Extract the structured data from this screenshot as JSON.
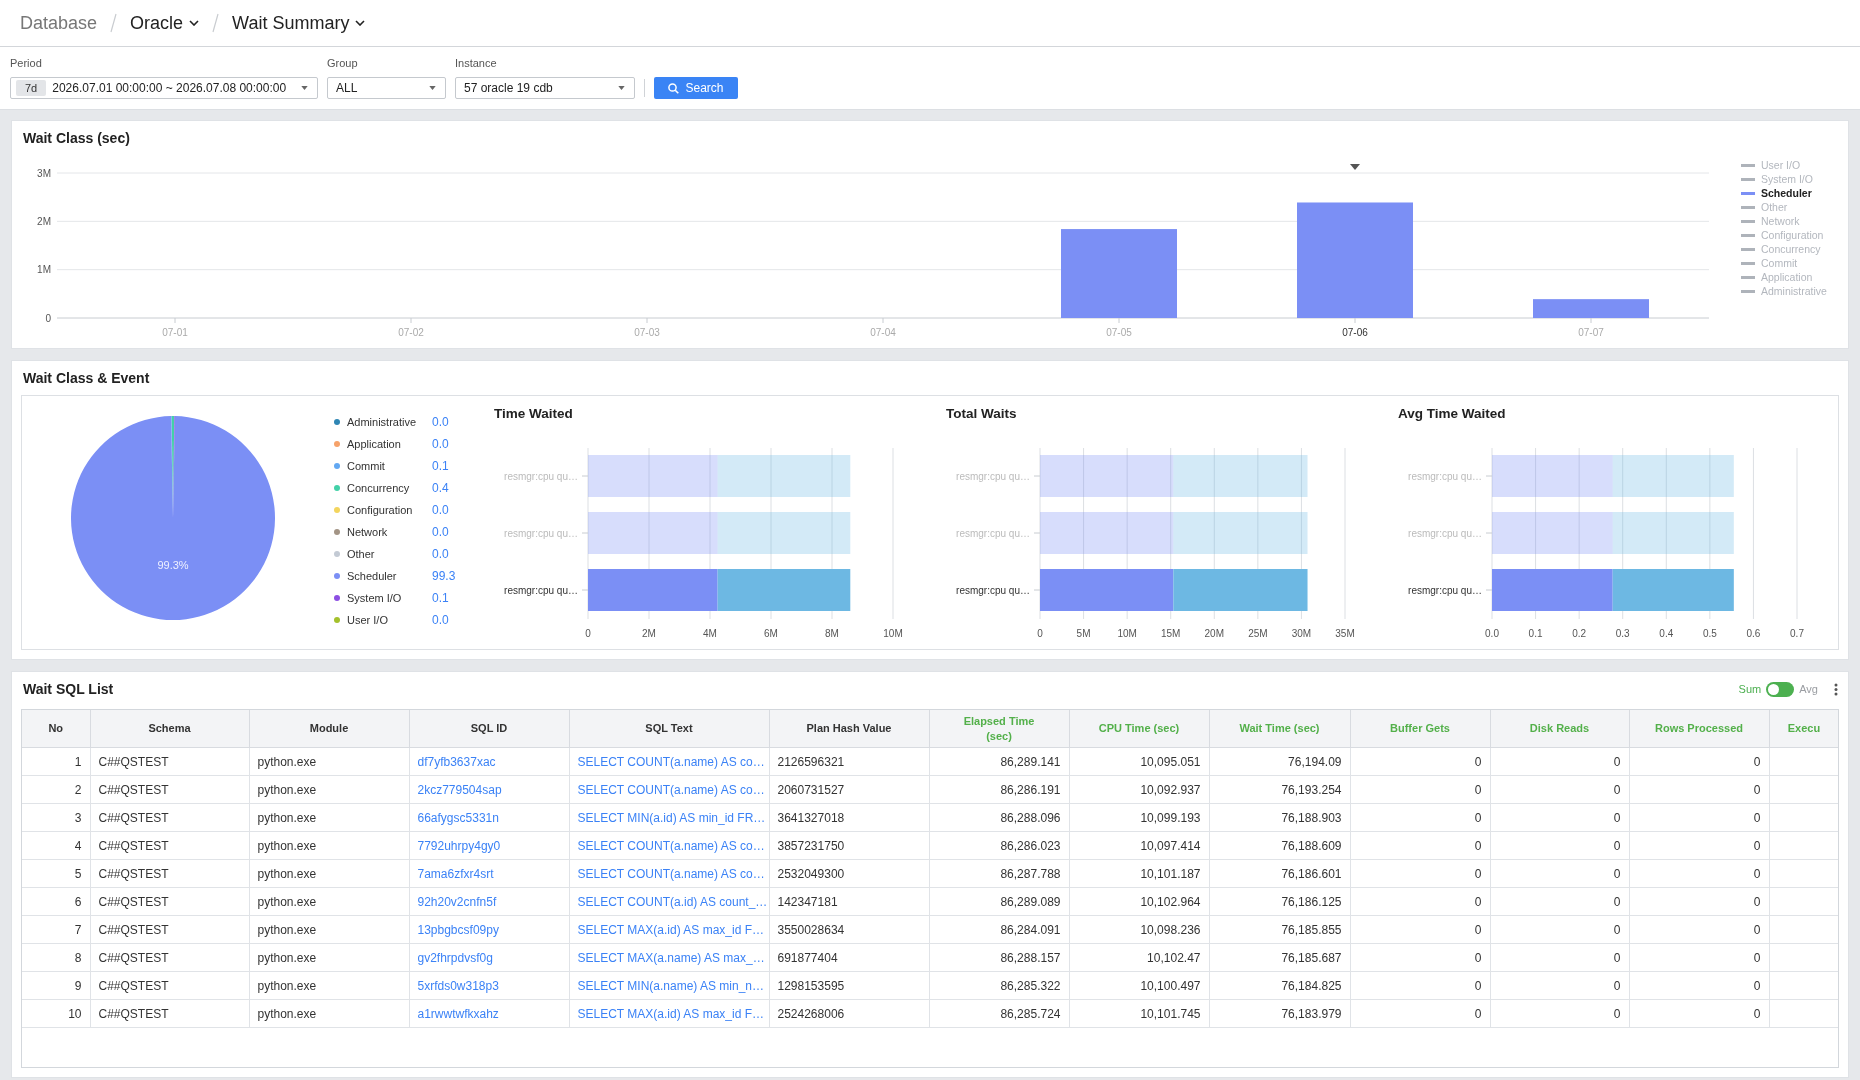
{
  "breadcrumb": [
    {
      "label": "Database",
      "dropdown": false
    },
    {
      "label": "Oracle",
      "dropdown": true
    },
    {
      "label": "Wait Summary",
      "dropdown": true
    }
  ],
  "filters": {
    "period": {
      "label": "Period",
      "badge": "7d",
      "value": "2026.07.01 00:00:00 ~ 2026.07.08 00:00:00"
    },
    "group": {
      "label": "Group",
      "value": "ALL"
    },
    "instance": {
      "label": "Instance",
      "value": "57 oracle 19 cdb"
    },
    "search_button": "Search"
  },
  "wait_class": {
    "title": "Wait Class (sec)",
    "category_states": [
      {
        "selected": false
      },
      {
        "selected": false
      },
      {
        "selected": false
      },
      {
        "selected": false
      },
      {
        "selected": false
      },
      {
        "selected": true
      },
      {
        "selected": false
      }
    ],
    "legend": [
      {
        "label": "User I/O",
        "selected": false
      },
      {
        "label": "System I/O",
        "selected": false
      },
      {
        "label": "Scheduler",
        "selected": true
      },
      {
        "label": "Other",
        "selected": false
      },
      {
        "label": "Network",
        "selected": false
      },
      {
        "label": "Configuration",
        "selected": false
      },
      {
        "label": "Concurrency",
        "selected": false
      },
      {
        "label": "Commit",
        "selected": false
      },
      {
        "label": "Application",
        "selected": false
      },
      {
        "label": "Administrative",
        "selected": false
      }
    ],
    "chart_data": {
      "type": "bar",
      "grid": true,
      "categories": [
        "07-01",
        "07-02",
        "07-03",
        "07-04",
        "07-05",
        "07-06",
        "07-07"
      ],
      "series": [
        {
          "color": "#7b8ff5",
          "values": [
            0,
            0,
            0,
            0,
            1840000,
            2390000,
            390000
          ]
        }
      ],
      "ylim": [
        0,
        3000000
      ],
      "yticks": [
        {
          "value": 0,
          "label": "0"
        },
        {
          "value": 1000000,
          "label": "1M"
        },
        {
          "value": 2000000,
          "label": "2M"
        },
        {
          "value": 3000000,
          "label": "3M"
        }
      ]
    }
  },
  "wait_class_event": {
    "title": "Wait Class & Event",
    "pie": {
      "legend": [
        {
          "label": "Administrative",
          "value": "0.0",
          "color": "#2f86b4"
        },
        {
          "label": "Application",
          "value": "0.0",
          "color": "#f6a26a"
        },
        {
          "label": "Commit",
          "value": "0.1",
          "color": "#62a8f2"
        },
        {
          "label": "Concurrency",
          "value": "0.4",
          "color": "#43d1a8"
        },
        {
          "label": "Configuration",
          "value": "0.0",
          "color": "#f3d55e"
        },
        {
          "label": "Network",
          "value": "0.0",
          "color": "#a39485"
        },
        {
          "label": "Other",
          "value": "0.0",
          "color": "#c3cad4"
        },
        {
          "label": "Scheduler",
          "value": "99.3",
          "color": "#7b8ff5"
        },
        {
          "label": "System I/O",
          "value": "0.1",
          "color": "#8c4fe3"
        },
        {
          "label": "User I/O",
          "value": "0.0",
          "color": "#a4c12c"
        }
      ],
      "chart_data": {
        "type": "pie",
        "values": [
          0,
          0,
          0.1,
          0.4,
          0,
          0,
          0,
          99.3,
          0.1,
          0
        ],
        "annotations": [
          {
            "text": "99.3%"
          }
        ]
      }
    },
    "charts": [
      {
        "bars": [
          {
            "selected": false
          },
          {
            "selected": false
          },
          {
            "selected": true
          }
        ],
        "chart_data": {
          "type": "bar",
          "title": "Time Waited",
          "orientation": "horizontal",
          "stacked": true,
          "grid": true,
          "categories": [
            "resmgr:cpu qu…",
            "resmgr:cpu qu…",
            "resmgr:cpu qu…"
          ],
          "series": [
            {
              "color": "#7b8ff5",
              "values": [
                4250000,
                4250000,
                4250000
              ]
            },
            {
              "color": "#6db8e3",
              "values": [
                4350000,
                4350000,
                4350000
              ]
            }
          ],
          "xlim": [
            0,
            10000000
          ],
          "xticks": [
            {
              "value": 0,
              "label": "0"
            },
            {
              "value": 2000000,
              "label": "2M"
            },
            {
              "value": 4000000,
              "label": "4M"
            },
            {
              "value": 6000000,
              "label": "6M"
            },
            {
              "value": 8000000,
              "label": "8M"
            },
            {
              "value": 10000000,
              "label": "10M"
            }
          ]
        }
      },
      {
        "bars": [
          {
            "selected": false
          },
          {
            "selected": false
          },
          {
            "selected": true
          }
        ],
        "chart_data": {
          "type": "bar",
          "title": "Total Waits",
          "orientation": "horizontal",
          "stacked": true,
          "grid": true,
          "categories": [
            "resmgr:cpu qu…",
            "resmgr:cpu qu…",
            "resmgr:cpu qu…"
          ],
          "series": [
            {
              "color": "#7b8ff5",
              "values": [
                15300000,
                15300000,
                15300000
              ]
            },
            {
              "color": "#6db8e3",
              "values": [
                15400000,
                15400000,
                15400000
              ]
            }
          ],
          "xlim": [
            0,
            35000000
          ],
          "xticks": [
            {
              "value": 0,
              "label": "0"
            },
            {
              "value": 5000000,
              "label": "5M"
            },
            {
              "value": 10000000,
              "label": "10M"
            },
            {
              "value": 15000000,
              "label": "15M"
            },
            {
              "value": 20000000,
              "label": "20M"
            },
            {
              "value": 25000000,
              "label": "25M"
            },
            {
              "value": 30000000,
              "label": "30M"
            },
            {
              "value": 35000000,
              "label": "35M"
            }
          ]
        }
      },
      {
        "bars": [
          {
            "selected": false
          },
          {
            "selected": false
          },
          {
            "selected": true
          }
        ],
        "chart_data": {
          "type": "bar",
          "title": "Avg Time Waited",
          "orientation": "horizontal",
          "stacked": true,
          "grid": true,
          "categories": [
            "resmgr:cpu qu…",
            "resmgr:cpu qu…",
            "resmgr:cpu qu…"
          ],
          "series": [
            {
              "color": "#7b8ff5",
              "values": [
                0.277,
                0.277,
                0.277
              ]
            },
            {
              "color": "#6db8e3",
              "values": [
                0.278,
                0.278,
                0.278
              ]
            }
          ],
          "xlim": [
            0,
            0.7
          ],
          "xticks": [
            {
              "value": 0,
              "label": "0.0"
            },
            {
              "value": 0.1,
              "label": "0.1"
            },
            {
              "value": 0.2,
              "label": "0.2"
            },
            {
              "value": 0.3,
              "label": "0.3"
            },
            {
              "value": 0.4,
              "label": "0.4"
            },
            {
              "value": 0.5,
              "label": "0.5"
            },
            {
              "value": 0.6,
              "label": "0.6"
            },
            {
              "value": 0.7,
              "label": "0.7"
            }
          ]
        }
      }
    ]
  },
  "wait_sql_list": {
    "title": "Wait SQL List",
    "toggle": {
      "options": [
        {
          "label": "Sum",
          "selected": true
        },
        {
          "label": "Avg",
          "selected": false
        }
      ]
    },
    "table": {
      "columns": [
        {
          "label": "No",
          "kind": "index"
        },
        {
          "label": "Schema",
          "kind": "text"
        },
        {
          "label": "Module",
          "kind": "text"
        },
        {
          "label": "SQL ID",
          "kind": "link"
        },
        {
          "label": "SQL Text",
          "kind": "link"
        },
        {
          "label": "Plan Hash Value",
          "kind": "text"
        },
        {
          "label": "Elapsed Time (sec)",
          "kind": "metric"
        },
        {
          "label": "CPU Time (sec)",
          "kind": "metric"
        },
        {
          "label": "Wait Time (sec)",
          "kind": "metric"
        },
        {
          "label": "Buffer Gets",
          "kind": "metric"
        },
        {
          "label": "Disk Reads",
          "kind": "metric"
        },
        {
          "label": "Rows Processed",
          "kind": "metric"
        },
        {
          "label": "Execu",
          "kind": "metric"
        }
      ],
      "rows": [
        {
          "cells": [
            "1",
            "C##QSTEST",
            "python.exe",
            "df7yfb3637xac",
            "SELECT COUNT(a.name) AS co…",
            "2126596321",
            "86,289.141",
            "10,095.051",
            "76,194.09",
            "0",
            "0",
            "0"
          ]
        },
        {
          "cells": [
            "2",
            "C##QSTEST",
            "python.exe",
            "2kcz779504sap",
            "SELECT COUNT(a.name) AS co…",
            "2060731527",
            "86,286.191",
            "10,092.937",
            "76,193.254",
            "0",
            "0",
            "0"
          ]
        },
        {
          "cells": [
            "3",
            "C##QSTEST",
            "python.exe",
            "66afygsc5331n",
            "SELECT MIN(a.id) AS min_id FR…",
            "3641327018",
            "86,288.096",
            "10,099.193",
            "76,188.903",
            "0",
            "0",
            "0"
          ]
        },
        {
          "cells": [
            "4",
            "C##QSTEST",
            "python.exe",
            "7792uhrpy4gy0",
            "SELECT COUNT(a.name) AS co…",
            "3857231750",
            "86,286.023",
            "10,097.414",
            "76,188.609",
            "0",
            "0",
            "0"
          ]
        },
        {
          "cells": [
            "5",
            "C##QSTEST",
            "python.exe",
            "7ama6zfxr4srt",
            "SELECT COUNT(a.name) AS co…",
            "2532049300",
            "86,287.788",
            "10,101.187",
            "76,186.601",
            "0",
            "0",
            "0"
          ]
        },
        {
          "cells": [
            "6",
            "C##QSTEST",
            "python.exe",
            "92h20v2cnfn5f",
            "SELECT COUNT(a.id) AS count_…",
            "142347181",
            "86,289.089",
            "10,102.964",
            "76,186.125",
            "0",
            "0",
            "0"
          ]
        },
        {
          "cells": [
            "7",
            "C##QSTEST",
            "python.exe",
            "13pbgbcsf09py",
            "SELECT MAX(a.id) AS max_id F…",
            "3550028634",
            "86,284.091",
            "10,098.236",
            "76,185.855",
            "0",
            "0",
            "0"
          ]
        },
        {
          "cells": [
            "8",
            "C##QSTEST",
            "python.exe",
            "gv2fhrpdvsf0g",
            "SELECT MAX(a.name) AS max_…",
            "691877404",
            "86,288.157",
            "10,102.47",
            "76,185.687",
            "0",
            "0",
            "0"
          ]
        },
        {
          "cells": [
            "9",
            "C##QSTEST",
            "python.exe",
            "5xrfds0w318p3",
            "SELECT MIN(a.name) AS min_n…",
            "1298153595",
            "86,285.322",
            "10,100.497",
            "76,184.825",
            "0",
            "0",
            "0"
          ]
        },
        {
          "cells": [
            "10",
            "C##QSTEST",
            "python.exe",
            "a1rwwtwfkxahz",
            "SELECT MAX(a.id) AS max_id F…",
            "2524268006",
            "86,285.724",
            "10,101.745",
            "76,183.979",
            "0",
            "0",
            "0"
          ]
        }
      ]
    }
  }
}
